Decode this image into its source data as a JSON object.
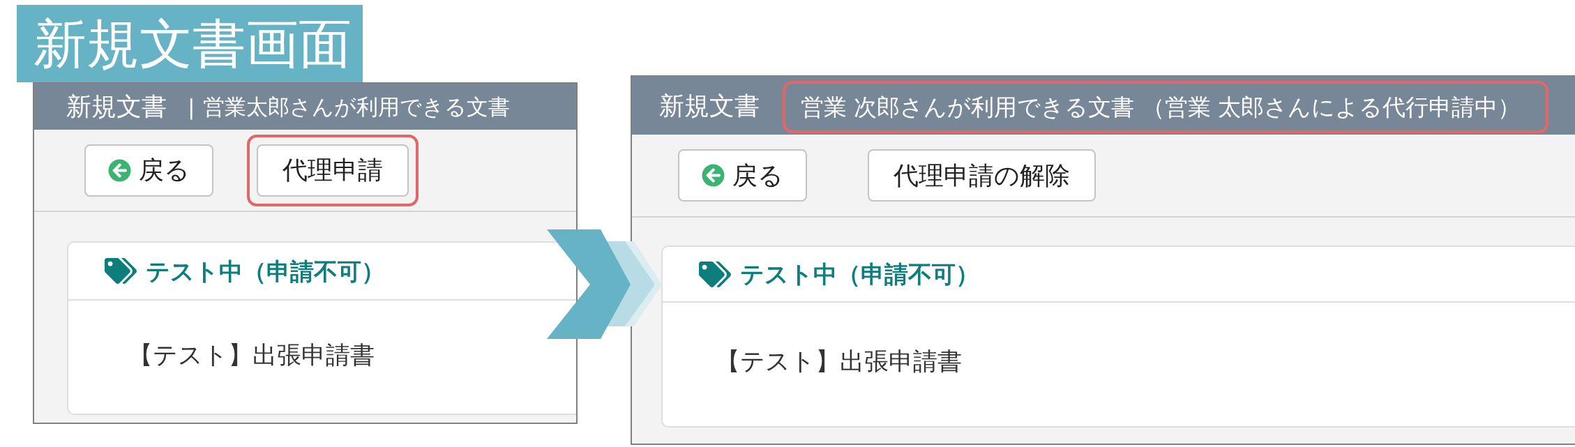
{
  "title_banner": {
    "text": "新規文書画面"
  },
  "screens": [
    {
      "header": {
        "title": "新規文書",
        "separator": "|",
        "subtitle": "営業太郎さんが利用できる文書",
        "highlighted": false
      },
      "toolbar": [
        {
          "kind": "back",
          "label": "戻る",
          "highlighted": false
        },
        {
          "kind": "text",
          "label": "代理申請",
          "highlighted": true
        }
      ],
      "group": {
        "heading": "テスト中（申請不可）",
        "documents": [
          "【テスト】出張申請書"
        ]
      }
    },
    {
      "header": {
        "title": "新規文書",
        "subtitle": "営業 次郎さんが利用できる文書 （営業 太郎さんによる代行申請中）",
        "highlighted": true
      },
      "toolbar": [
        {
          "kind": "back",
          "label": "戻る",
          "highlighted": false
        },
        {
          "kind": "text",
          "label": "代理申請の解除",
          "highlighted": false
        }
      ],
      "group": {
        "heading": "テスト中（申請不可）",
        "documents": [
          "【テスト】出張申請書"
        ]
      }
    }
  ]
}
